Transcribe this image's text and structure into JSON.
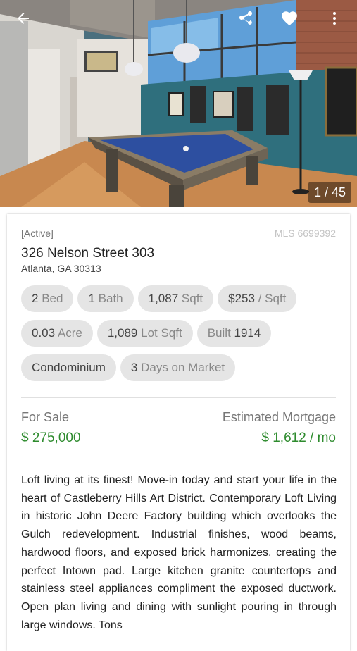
{
  "topbar": {
    "back_icon": "arrow-left-icon",
    "share_icon": "share-icon",
    "favorite_icon": "heart-icon",
    "more_icon": "more-vertical-icon"
  },
  "photo": {
    "counter": "1 / 45"
  },
  "listing": {
    "status": "[Active]",
    "mls": "MLS 6699392",
    "address_line1": "326 Nelson Street 303",
    "address_line2": "Atlanta, GA 30313",
    "chips": [
      {
        "num": "2",
        "unit": " Bed"
      },
      {
        "num": "1",
        "unit": " Bath"
      },
      {
        "num": "1,087",
        "unit": " Sqft"
      },
      {
        "num": "$253",
        "unit": " / Sqft"
      },
      {
        "num": "0.03",
        "unit": " Acre"
      },
      {
        "num": "1,089",
        "unit": " Lot Sqft"
      },
      {
        "num": "Built ",
        "unit": "1914"
      },
      {
        "num": "Condominium",
        "unit": ""
      },
      {
        "num": "3",
        "unit": " Days on Market"
      }
    ],
    "sale_label": "For Sale",
    "sale_price": "$ 275,000",
    "mortgage_label": "Estimated Mortgage",
    "mortgage_value": "$ 1,612 / mo",
    "description": "Loft living at its finest! Move-in today and start your life in the heart of Castleberry Hills Art District. Contemporary Loft Living in historic John Deere Factory building which overlooks the Gulch redevelopment. Industrial finishes, wood beams, hardwood floors, and exposed brick harmonizes, creating the perfect Intown pad. Large kitchen granite countertops and stainless steel appliances compliment the exposed ductwork. Open plan living and dining with sunlight pouring in through large windows. Tons"
  },
  "colors": {
    "price_green": "#2e8b2e",
    "chip_bg": "#e5e5e5"
  }
}
